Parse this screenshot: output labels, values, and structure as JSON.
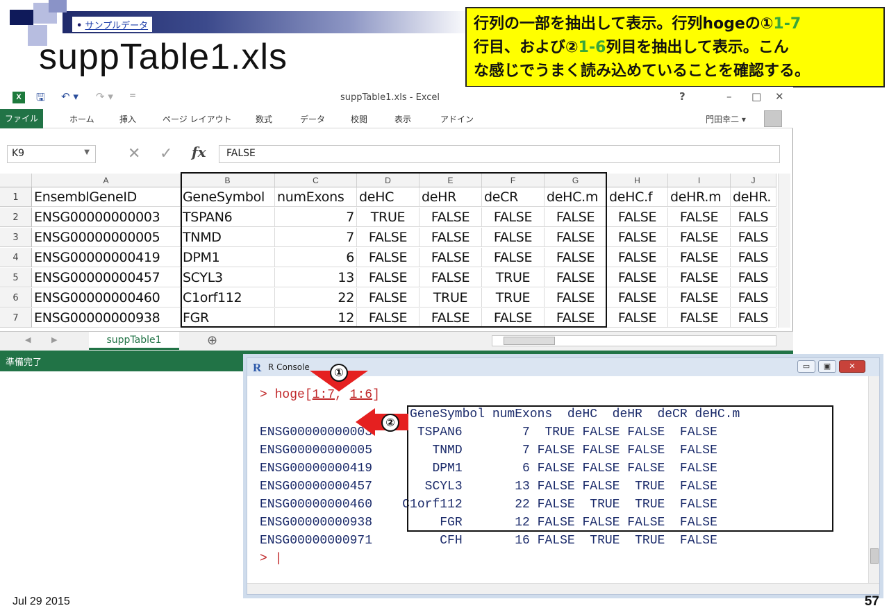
{
  "slide": {
    "breadcrumb_bullet": "•",
    "breadcrumb": "サンプルデータ",
    "title": "suppTable1.xls",
    "note_line1_a": "行列の一部を抽出して表示。行列hogeの①",
    "note_line1_b": "1-7",
    "note_line2_a": "行目、および②",
    "note_line2_b": "1-6",
    "note_line2_c": "列目を抽出して表示。こん",
    "note_line3": "な感じでうまく読み込めていることを確認する。",
    "date": "Jul 29 2015",
    "page_number": "57"
  },
  "excel": {
    "window_caption": "suppTable1.xls - Excel",
    "qat_save": "🖫",
    "qat_undo": "↶ ▾",
    "qat_redo": "↷ ▾",
    "qat_more": "=",
    "help": "?",
    "minimize": "–",
    "restore": "□",
    "close": "✕",
    "tabs": [
      "ファイル",
      "ホーム",
      "挿入",
      "ページ レイアウト",
      "数式",
      "データ",
      "校閲",
      "表示",
      "アドイン"
    ],
    "user": "門田幸二 ▾",
    "name_box": "K9",
    "formula_cancel": "✕",
    "formula_enter": "✓",
    "formula_fx": "fx",
    "formula_value": "FALSE",
    "columns": [
      "A",
      "B",
      "C",
      "D",
      "E",
      "F",
      "G",
      "H",
      "I",
      "J"
    ],
    "rows": [
      [
        "EnsemblGeneID",
        "GeneSymbol",
        "numExons",
        "deHC",
        "deHR",
        "deCR",
        "deHC.m",
        "deHC.f",
        "deHR.m",
        "deHR."
      ],
      [
        "ENSG00000000003",
        "TSPAN6",
        "7",
        "TRUE",
        "FALSE",
        "FALSE",
        "FALSE",
        "FALSE",
        "FALSE",
        "FALS"
      ],
      [
        "ENSG00000000005",
        "TNMD",
        "7",
        "FALSE",
        "FALSE",
        "FALSE",
        "FALSE",
        "FALSE",
        "FALSE",
        "FALS"
      ],
      [
        "ENSG00000000419",
        "DPM1",
        "6",
        "FALSE",
        "FALSE",
        "FALSE",
        "FALSE",
        "FALSE",
        "FALSE",
        "FALS"
      ],
      [
        "ENSG00000000457",
        "SCYL3",
        "13",
        "FALSE",
        "FALSE",
        "TRUE",
        "FALSE",
        "FALSE",
        "FALSE",
        "FALS"
      ],
      [
        "ENSG00000000460",
        "C1orf112",
        "22",
        "FALSE",
        "TRUE",
        "TRUE",
        "FALSE",
        "FALSE",
        "FALSE",
        "FALS"
      ],
      [
        "ENSG00000000938",
        "FGR",
        "12",
        "FALSE",
        "FALSE",
        "FALSE",
        "FALSE",
        "FALSE",
        "FALSE",
        "FALS"
      ]
    ],
    "row_numbers": [
      "1",
      "2",
      "3",
      "4",
      "5",
      "6",
      "7"
    ],
    "sheet_tab": "suppTable1",
    "add_sheet": "⊕",
    "status": "準備完了"
  },
  "rconsole": {
    "caption": "R Console",
    "prompt": ">",
    "cmd_pre": "hoge[",
    "cmd_rows": "1:7",
    "cmd_mid": ", ",
    "cmd_cols": "1:6",
    "cmd_post": "]",
    "header": "GeneSymbol numExons  deHC  deHR  deCR deHC.m",
    "lines": [
      "ENSG00000000003      TSPAN6        7  TRUE FALSE FALSE  FALSE",
      "ENSG00000000005        TNMD        7 FALSE FALSE FALSE  FALSE",
      "ENSG00000000419        DPM1        6 FALSE FALSE FALSE  FALSE",
      "ENSG00000000457       SCYL3       13 FALSE FALSE  TRUE  FALSE",
      "ENSG00000000460    C1orf112       22 FALSE  TRUE  TRUE  FALSE",
      "ENSG00000000938         FGR       12 FALSE FALSE FALSE  FALSE",
      "ENSG00000000971         CFH       16 FALSE  TRUE  TRUE  FALSE"
    ],
    "cursor_prompt": "> ",
    "cursor": "|",
    "marker1": "①",
    "marker2": "②",
    "btn_min": "▭",
    "btn_max": "▣",
    "btn_close": "✕"
  }
}
